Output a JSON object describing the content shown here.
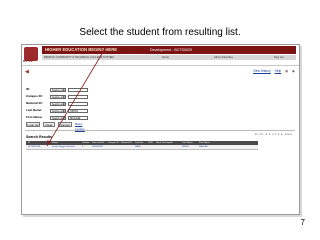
{
  "slide": {
    "title": "Select the student from resulting list.",
    "number": "7"
  },
  "header": {
    "logo_text": "BOYCE",
    "banner": "HIGHER EDUCATION BEGINS HERE",
    "environment": "Development - BCTS0029",
    "sub_items": [
      "BRISTOL COMMUNITY & TECHNICAL COLLEGE SYSTEM",
      "Home",
      "Add to Favorites",
      "Sign out"
    ]
  },
  "top_links": {
    "view_history": "View History",
    "help": "Help",
    "icons": [
      "print-icon",
      "new-window-icon"
    ]
  },
  "form": {
    "fields": [
      {
        "label": "ID:",
        "operator": "begins with",
        "value": ""
      },
      {
        "label": "Campus ID:",
        "operator": "begins with",
        "value": ""
      },
      {
        "label": "National ID:",
        "operator": "begins with",
        "value": ""
      },
      {
        "label": "Last Name:",
        "operator": "begins with",
        "value": "SMITH"
      },
      {
        "label": "First Name:",
        "operator": "begins with",
        "value": "MAGGIE"
      }
    ]
  },
  "buttons": {
    "lookup": "Look Up",
    "clear": "Clear",
    "cancel": "Cancel",
    "basic_lookup": "Basic Lookup"
  },
  "results": {
    "title": "Search Results",
    "pager": "First ◂ 1 of 1 ▸ Last",
    "columns": [
      "ID",
      "Name",
      "Gender",
      "Date of Birth",
      "Campus ID",
      "National ID",
      "Location",
      "SSN",
      "Short Description",
      "Last Name",
      "First Name"
    ],
    "rows": [
      [
        "0123456789",
        "Smith, Maggie Michelle",
        "F",
        "06/05/1987",
        "",
        "",
        "MAIN",
        "",
        "SMITH",
        "MAGGIE"
      ]
    ]
  },
  "colors": {
    "banner": "#7d1414",
    "link": "#1a3f9a",
    "arrow": "#8b1a1a"
  }
}
